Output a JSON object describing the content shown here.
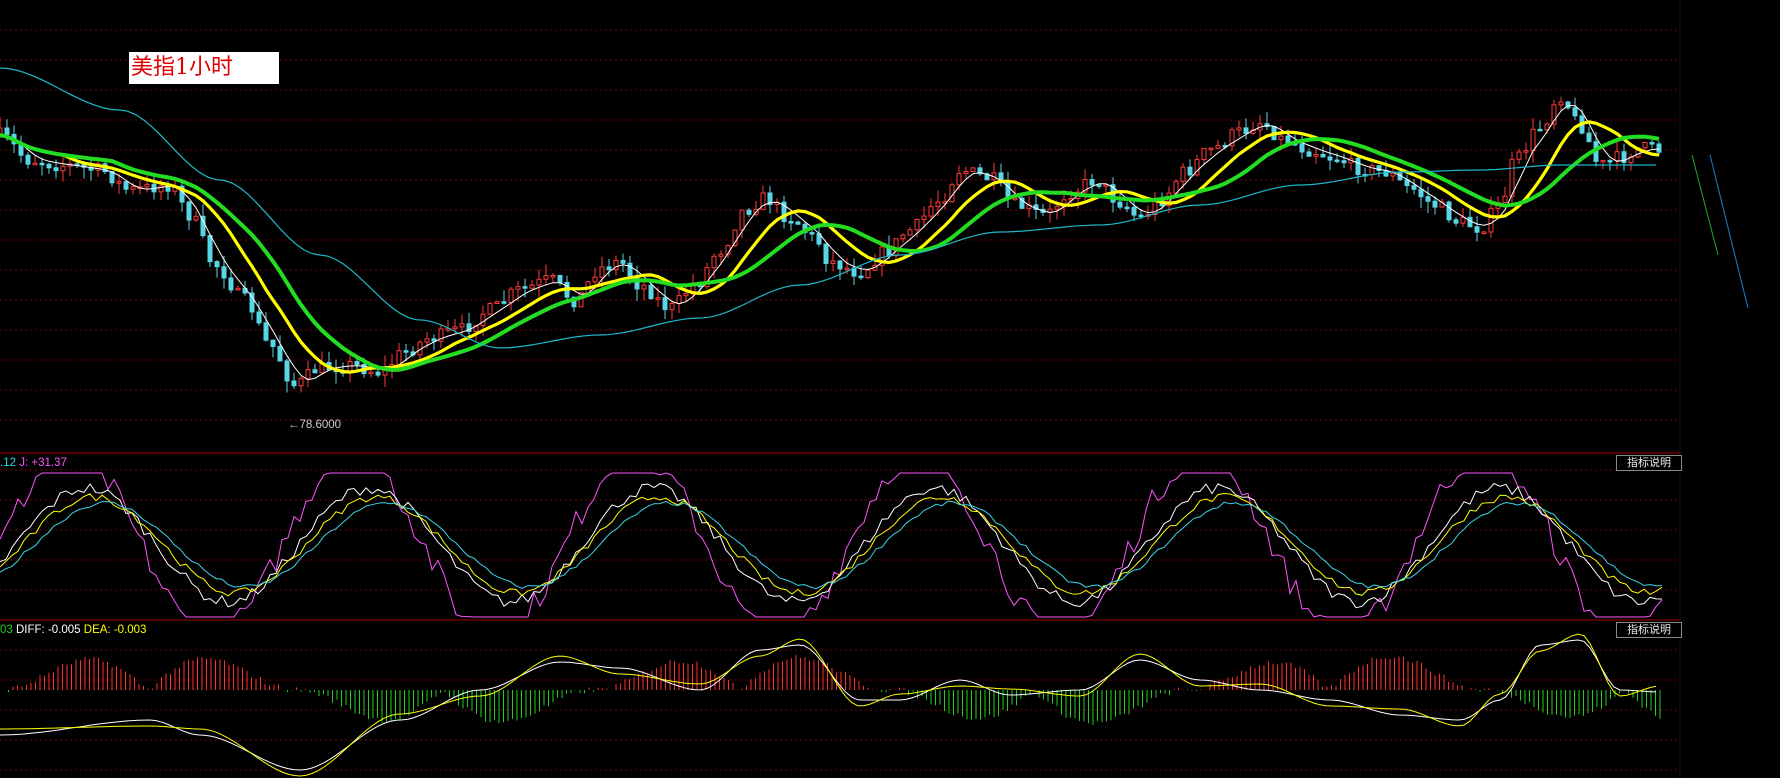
{
  "title": "美指1小时",
  "main_panel": {
    "low_marker": "←78.6000"
  },
  "kdj_panel": {
    "header_fragment": ".12",
    "j_label": "J:",
    "j_value": "+31.37",
    "explain_button": "指标说明"
  },
  "macd_panel": {
    "header_fragment": "03",
    "diff_label": "DIFF:",
    "diff_value": "-0.005",
    "dea_label": "DEA:",
    "dea_value": "-0.003",
    "explain_button": "指标说明"
  },
  "colors": {
    "up": "#ff3a3a",
    "down": "#58d6e6",
    "ma_thin": "#ffffff",
    "ma_yellow": "#ffff00",
    "ma_green": "#22dd22",
    "ma_cyan": "#1eb8c8",
    "kdj_k": "#ffffff",
    "kdj_d": "#ffff00",
    "kdj_j": "#ff55ff",
    "kdj_alt": "#3ad6e6",
    "macd_pos": "#ff3030",
    "macd_neg": "#22cc22",
    "grid": "#7a0000"
  },
  "chart_data": [
    {
      "type": "candlestick",
      "title": "美指1小时",
      "annotation": "←78.6000",
      "series": [
        {
          "name": "",
          "type": "candles",
          "values": "hourly OHLC (shape only)"
        },
        {
          "name": "",
          "type": "line",
          "color": "#ffffff"
        },
        {
          "name": "",
          "type": "line",
          "color": "#ffff00"
        },
        {
          "name": "",
          "type": "line",
          "color": "#22dd22"
        },
        {
          "name": "",
          "type": "line",
          "color": "#1eb8c8"
        }
      ],
      "y_min_marked": 78.6,
      "grid": true
    },
    {
      "type": "line",
      "indicator": "KDJ",
      "series": [
        {
          "name": "",
          "color": "#ffffff"
        },
        {
          "name": "",
          "color": "#ffff00"
        },
        {
          "name": "J",
          "color": "#ff55ff",
          "last": 31.37
        }
      ]
    },
    {
      "type": "bar",
      "indicator": "MACD",
      "series": [
        {
          "name": "DIFF",
          "color": "#ffffff",
          "last": -0.005
        },
        {
          "name": "DEA",
          "color": "#ffff00",
          "last": -0.003
        },
        {
          "name": "",
          "type": "histogram"
        }
      ]
    }
  ]
}
